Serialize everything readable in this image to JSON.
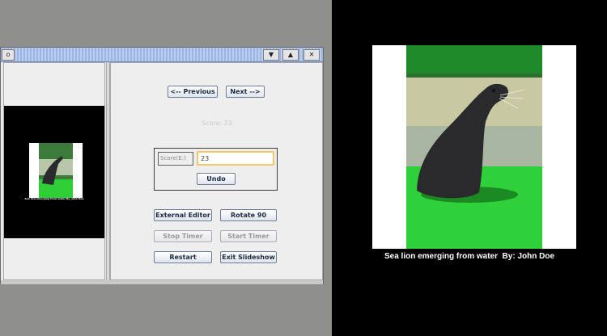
{
  "window": {
    "controls": {
      "menu": "o",
      "dropdown": "▼",
      "maximize": "▲",
      "close": "✕"
    }
  },
  "nav": {
    "previous_label": "<-- Previous",
    "next_label": "Next -->"
  },
  "score": {
    "faint_label": "Score: 23",
    "field_label": "Score(E:)",
    "value": "23",
    "undo_label": "Undo"
  },
  "actions": {
    "external_editor_label": "External Editor",
    "rotate_label": "Rotate 90",
    "stop_timer_label": "Stop Timer",
    "start_timer_label": "Start Timer",
    "restart_label": "Restart",
    "exit_slideshow_label": "Exit Slideshow"
  },
  "slide": {
    "caption": "Sea lion emerging from water  By: John Doe",
    "thumb_caption": "Sea lion emerging from water  By: John Doe"
  },
  "colors": {
    "accent_field_border": "#f1c86a",
    "titlebar": "#a9c0ea"
  }
}
